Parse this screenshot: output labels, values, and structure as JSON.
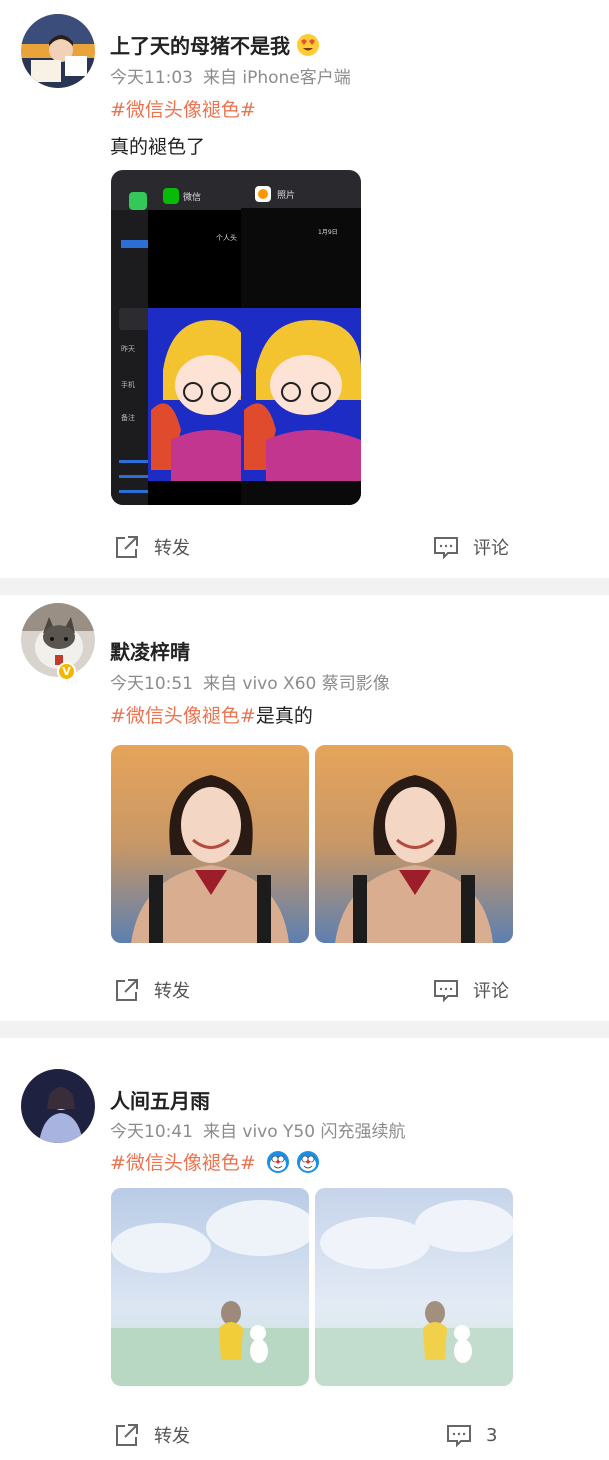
{
  "posts": [
    {
      "username": "上了天的母猪不是我",
      "time": "今天11:03",
      "source": "来自 iPhone客户端",
      "topic": "#微信头像褪色#",
      "text": "真的褪色了",
      "image_labels": {
        "phone": "",
        "wechat": "微信",
        "photos": "照片",
        "contact_title": "个人头",
        "photo_date": "1月9日",
        "yesterday": "昨天",
        "mobile": "手机",
        "note": "备注"
      },
      "repost_label": "转发",
      "comment_label": "评论"
    },
    {
      "username": "默凌梓晴",
      "time": "今天10:51",
      "source": "来自 vivo X60 蔡司影像",
      "topic": "#微信头像褪色#",
      "text": "是真的",
      "repost_label": "转发",
      "comment_label": "评论"
    },
    {
      "username": "人间五月雨",
      "time": "今天10:41",
      "source": "来自 vivo Y50 闪充强续航",
      "topic": "#微信头像褪色#",
      "text": "",
      "repost_label": "转发",
      "comment_label": "3"
    }
  ],
  "colors": {
    "topic": "#eb7350",
    "verified_badge": "#f7b500",
    "separator": "#f2f2f2"
  },
  "icons": {
    "repost": "share-box-icon",
    "comment": "comment-bubble-icon",
    "emoji": "doraemon-emoji-icon"
  }
}
